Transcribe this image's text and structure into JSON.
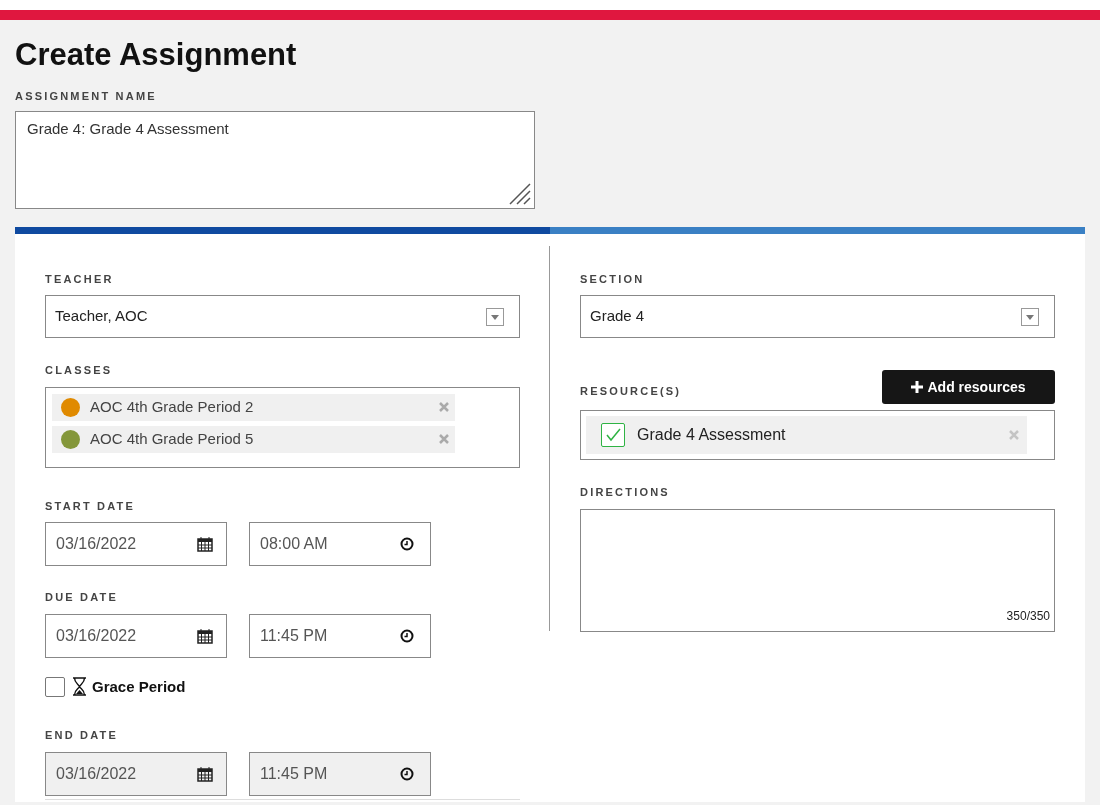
{
  "title": "Create Assignment",
  "assignment_name": {
    "label": "ASSIGNMENT NAME",
    "value": "Grade 4: Grade 4 Assessment"
  },
  "teacher": {
    "label": "TEACHER",
    "value": "Teacher, AOC"
  },
  "classes": {
    "label": "CLASSES",
    "items": [
      {
        "name": "AOC 4th Grade Period 2",
        "color": "#e08a00"
      },
      {
        "name": "AOC 4th Grade Period 5",
        "color": "#84973a"
      }
    ]
  },
  "start_date": {
    "label": "START DATE",
    "date": "03/16/2022",
    "time": "08:00 AM",
    "disabled": false
  },
  "due_date": {
    "label": "DUE DATE",
    "date": "03/16/2022",
    "time": "11:45 PM",
    "disabled": false
  },
  "grace_period": {
    "label": "Grace Period",
    "checked": false
  },
  "end_date": {
    "label": "END DATE",
    "date": "03/16/2022",
    "time": "11:45 PM",
    "disabled": true
  },
  "section": {
    "label": "SECTION",
    "value": "Grade 4"
  },
  "resources": {
    "label": "RESOURCE(S)",
    "button": "Add resources",
    "items": [
      {
        "name": "Grade 4 Assessment",
        "checked": true
      }
    ]
  },
  "directions": {
    "label": "DIRECTIONS",
    "counter": "350/350"
  }
}
